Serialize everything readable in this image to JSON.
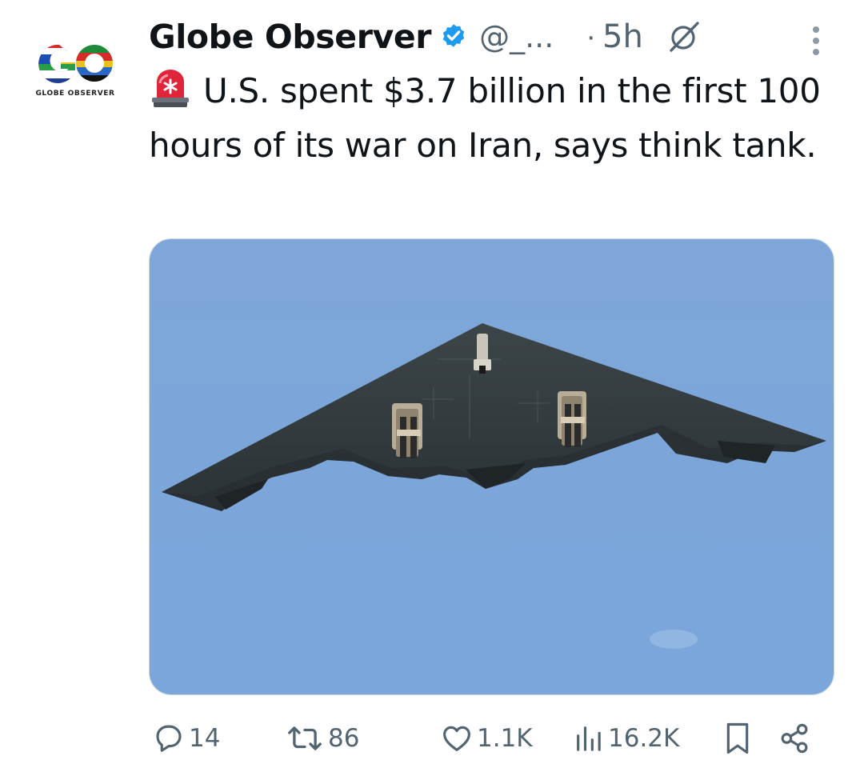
{
  "account": {
    "display_name": "Globe Observer",
    "handle": "@_...",
    "dot": "·",
    "time_ago": "5h",
    "avatar_logo_text": "GO",
    "avatar_caption": "GLOBE OBSERVER",
    "verified": true
  },
  "tweet": {
    "emoji": "siren",
    "text": "U.S. spent $3.7 billion in the first 100 hours of its war on Iran, says think tank."
  },
  "media": {
    "type": "photo",
    "subject": "stealth bomber aircraft against a blue sky"
  },
  "actions": {
    "replies": "14",
    "reposts": "86",
    "likes": "1.1K",
    "views": "16.2K"
  },
  "icons": {
    "verified": "verified-badge-icon",
    "grok": "grok-icon",
    "more": "more-vertical-icon",
    "reply": "reply-icon",
    "repost": "repost-icon",
    "like": "heart-icon",
    "views": "views-icon",
    "bookmark": "bookmark-icon",
    "share": "share-icon"
  },
  "colors": {
    "verified_blue": "#1d9bf0",
    "muted_text": "#536471",
    "text": "#0f1419",
    "sky": "#7aa6d9"
  }
}
